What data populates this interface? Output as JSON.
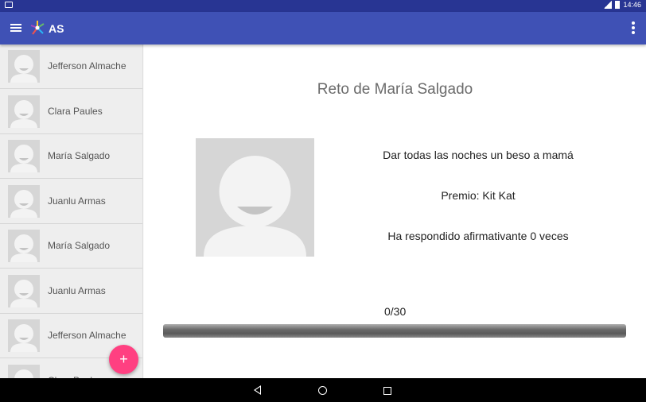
{
  "status_bar": {
    "time": "14:46"
  },
  "app_bar": {
    "title": "AS"
  },
  "sidebar": {
    "items": [
      {
        "name": "Jefferson Almache"
      },
      {
        "name": "Clara Paules"
      },
      {
        "name": "María Salgado"
      },
      {
        "name": "Juanlu Armas"
      },
      {
        "name": "María Salgado"
      },
      {
        "name": "Juanlu Armas"
      },
      {
        "name": "Jefferson Almache"
      },
      {
        "name": "Clara Paules"
      }
    ]
  },
  "fab": {
    "label": "+"
  },
  "main": {
    "title": "Reto de María Salgado",
    "description": "Dar todas las noches un beso a mamá",
    "prize": "Premio: Kit Kat",
    "responses": "Ha respondido afirmativante 0 veces",
    "progress_text": "0/30",
    "progress_value": 0,
    "progress_max": 30
  },
  "colors": {
    "primary": "#3f51b5",
    "primary_dark": "#283593",
    "accent": "#ff4081"
  },
  "icons": {
    "menu": "hamburger-icon",
    "logo": "app-logo-icon",
    "overflow": "more-vert-icon",
    "back": "nav-back-icon",
    "home": "nav-home-icon",
    "recents": "nav-recents-icon"
  }
}
